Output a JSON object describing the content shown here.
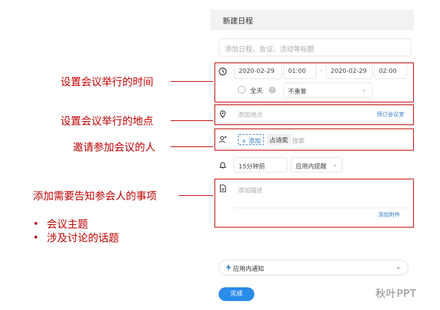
{
  "annotations": {
    "time": "设置会议举行的时间",
    "location": "设置会议举行的地点",
    "invite": "邀请参加会议的人",
    "notes": "添加需要告知参会人的事项",
    "bullets": [
      "会议主题",
      "涉及讨论的话题"
    ],
    "bullet_symbol": "•"
  },
  "panel": {
    "title": "新建日程",
    "title_placeholder": "添加日程、会议、活动等标题",
    "time": {
      "start_date": "2020-02-29",
      "start_time": "01:00",
      "separator": "-",
      "end_date": "2020-02-29",
      "end_time": "02:00",
      "all_day_label": "全天",
      "help_glyph": "?",
      "repeat_value": "不重复"
    },
    "location": {
      "placeholder": "添加地点",
      "book_room_label": "预订会议室"
    },
    "attendees": {
      "add_label": "+ 添加",
      "tag_label": "占诗奕",
      "search_placeholder": "搜索"
    },
    "reminder": {
      "time_value": "15分钟前",
      "type_value": "应用内提醒"
    },
    "description": {
      "placeholder": "添加描述",
      "attach_label": "添加附件"
    },
    "notification_label": "应用内通知",
    "done_label": "完成"
  },
  "watermark": "秋叶PPT",
  "colors": {
    "annotation": "#c00000",
    "accent": "#2b8be8",
    "link": "#3b82c4"
  }
}
